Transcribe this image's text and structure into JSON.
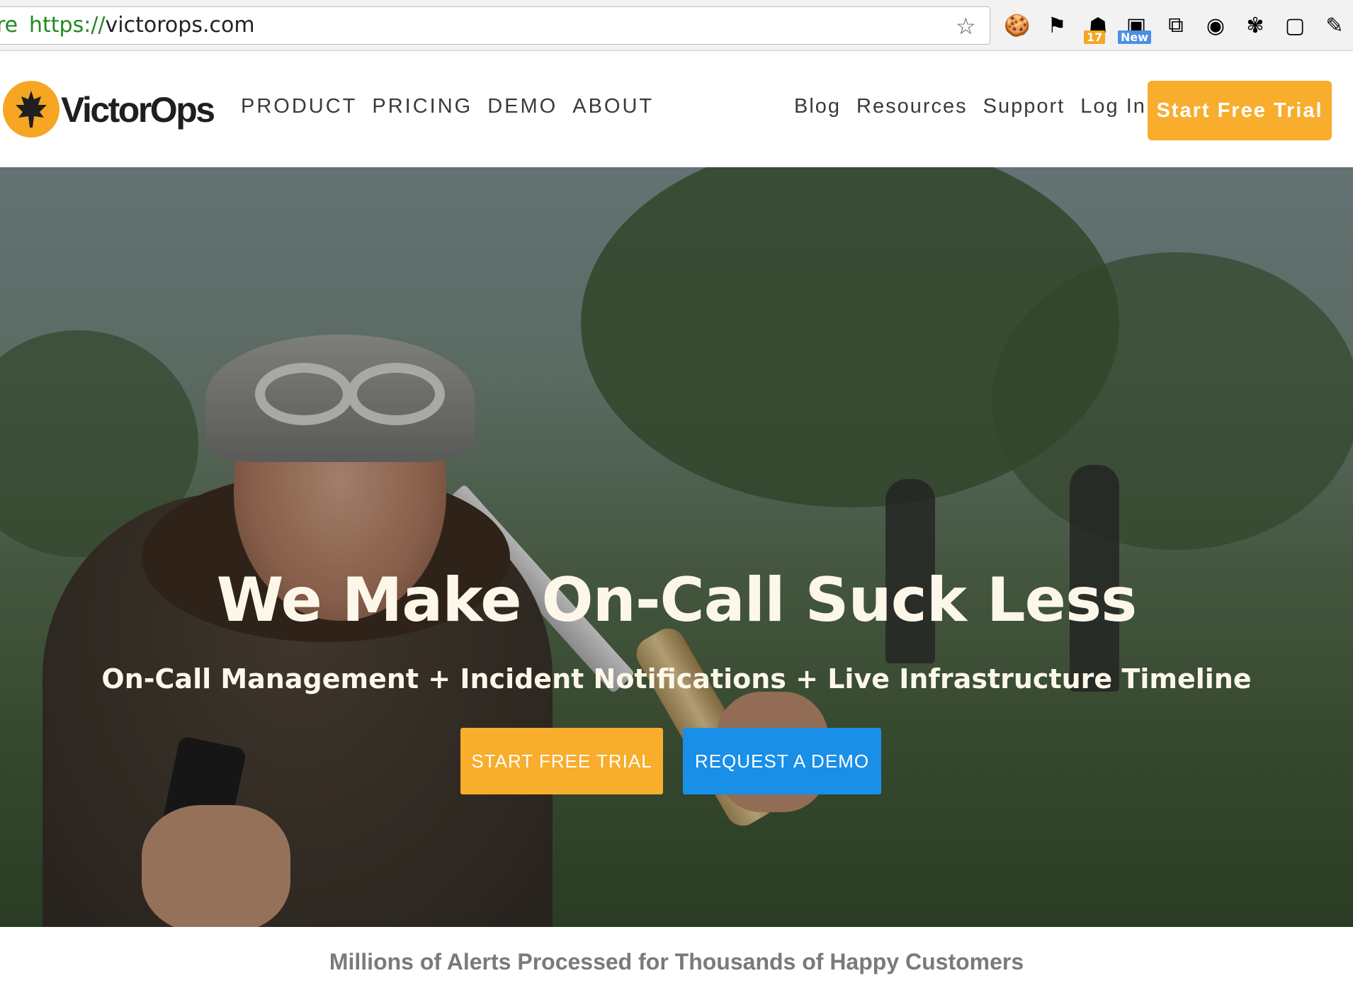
{
  "browser": {
    "scheme_tail": "re",
    "url_scheme": "https://",
    "url_host": "victorops.com",
    "bookmark_icon": "star-icon",
    "extensions": [
      {
        "name": "cookie-icon",
        "glyph": "🍪"
      },
      {
        "name": "flag-icon",
        "glyph": "⚑"
      },
      {
        "name": "calendar-ext-icon",
        "glyph": "☗",
        "badge": "17"
      },
      {
        "name": "news-ext-icon",
        "glyph": "▣",
        "badge": "New"
      },
      {
        "name": "code-ext-icon",
        "glyph": "⧉"
      },
      {
        "name": "github-icon",
        "glyph": "◉"
      },
      {
        "name": "palm-icon",
        "glyph": "✾"
      },
      {
        "name": "square-ext-icon",
        "glyph": "▢"
      },
      {
        "name": "note-ext-icon",
        "glyph": "✎"
      }
    ]
  },
  "header": {
    "brand": "VictorOps",
    "nav_left": [
      "PRODUCT",
      "PRICING",
      "DEMO",
      "ABOUT"
    ],
    "nav_right": [
      "Blog",
      "Resources",
      "Support",
      "Log In"
    ],
    "cta": "Start Free Trial"
  },
  "hero": {
    "title": "We Make On-Call Suck Less",
    "subtitle": "On-Call Management + Incident Notifications + Live Infrastructure Timeline",
    "primary_button": "START FREE TRIAL",
    "secondary_button": "REQUEST A DEMO"
  },
  "tagline": "Millions of Alerts Processed for Thousands of Happy Customers",
  "colors": {
    "accent_orange": "#f8ad2c",
    "accent_blue": "#1a8fe8",
    "hero_text": "#fdf7ea"
  }
}
